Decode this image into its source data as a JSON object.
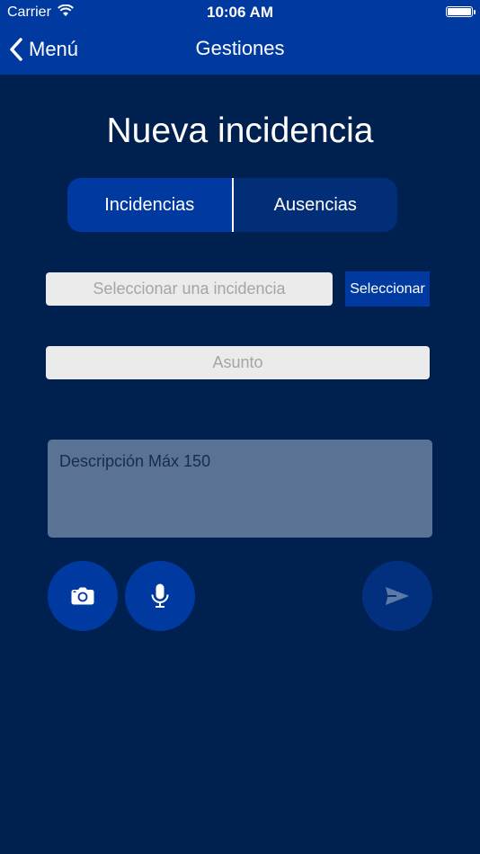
{
  "status_bar": {
    "carrier": "Carrier",
    "time": "10:06 AM"
  },
  "nav": {
    "back_label": "Menú",
    "title": "Gestiones"
  },
  "page_title": "Nueva incidencia",
  "segments": [
    {
      "label": "Incidencias",
      "selected": true
    },
    {
      "label": "Ausencias",
      "selected": false
    }
  ],
  "incidencia_field": {
    "placeholder": "Seleccionar una incidencia",
    "value": ""
  },
  "select_button": {
    "label": "Seleccionar"
  },
  "asunto_field": {
    "placeholder": "Asunto",
    "value": ""
  },
  "description_field": {
    "placeholder": "Descripción Máx 150",
    "value": ""
  },
  "actions": {
    "camera_icon": "camera-icon",
    "mic_icon": "microphone-icon",
    "send_icon": "send-icon"
  },
  "colors": {
    "nav_bar": "#003aa0",
    "background": "#00204f",
    "accent": "#003aa0",
    "description_bg": "#5a7294"
  }
}
